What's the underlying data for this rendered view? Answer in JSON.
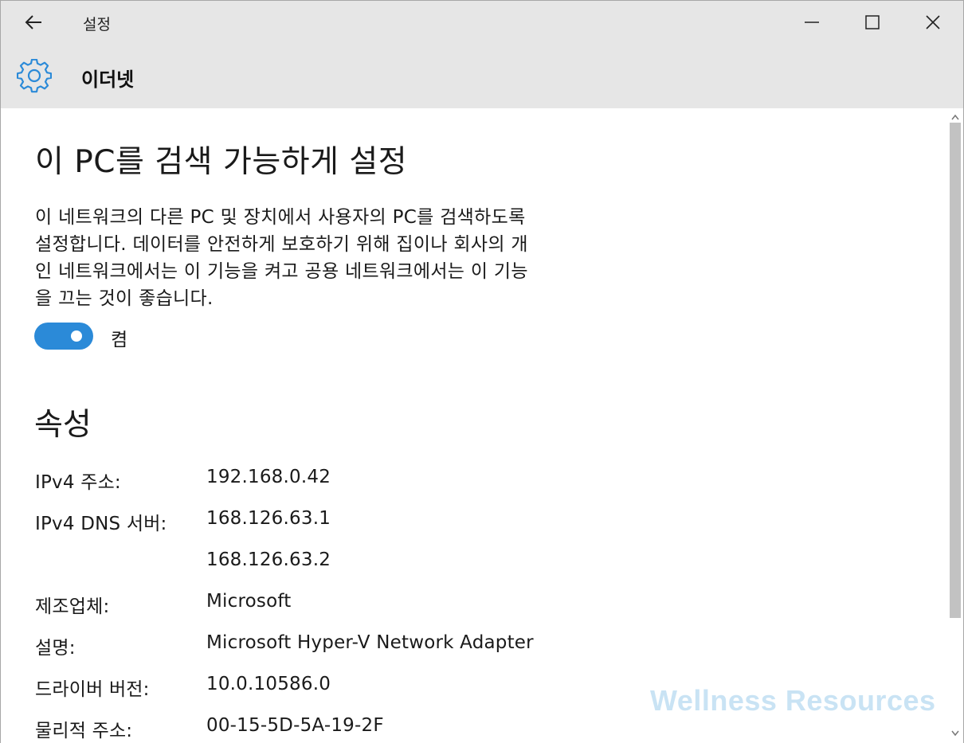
{
  "window": {
    "app_title": "설정",
    "controls": {
      "minimize": "minimize-icon",
      "maximize": "maximize-icon",
      "close": "close-icon"
    }
  },
  "header": {
    "icon": "gear-icon",
    "title": "이더넷"
  },
  "discoverable": {
    "heading": "이 PC를 검색 가능하게 설정",
    "description_lines": [
      "이 네트워크의 다른 PC 및 장치에서 사용자의 PC를 검색하도록",
      "설정합니다. 데이터를 안전하게 보호하기 위해 집이나 회사의 개",
      "인 네트워크에서는 이 기능을 켜고 공용 네트워크에서는 이 기능",
      "을 끄는 것이 좋습니다."
    ],
    "toggle_state": "on",
    "toggle_label": "켬"
  },
  "properties": {
    "heading": "속성",
    "rows": [
      {
        "label": "IPv4 주소:",
        "value": "192.168.0.42"
      },
      {
        "label": "IPv4 DNS 서버:",
        "value": "168.126.63.1"
      },
      {
        "label": "",
        "value": "168.126.63.2"
      },
      {
        "label": "제조업체:",
        "value": "Microsoft"
      },
      {
        "label": "설명:",
        "value": "Microsoft Hyper-V Network Adapter"
      },
      {
        "label": "드라이버 버전:",
        "value": "10.0.10586.0"
      },
      {
        "label": "물리적 주소:",
        "value": "00-15-5D-5A-19-2F"
      }
    ]
  },
  "watermark": "Wellness Resources",
  "colors": {
    "accent": "#2b8ad8",
    "chrome": "#e6e6e6",
    "scroll_thumb": "#c2c2c2"
  }
}
